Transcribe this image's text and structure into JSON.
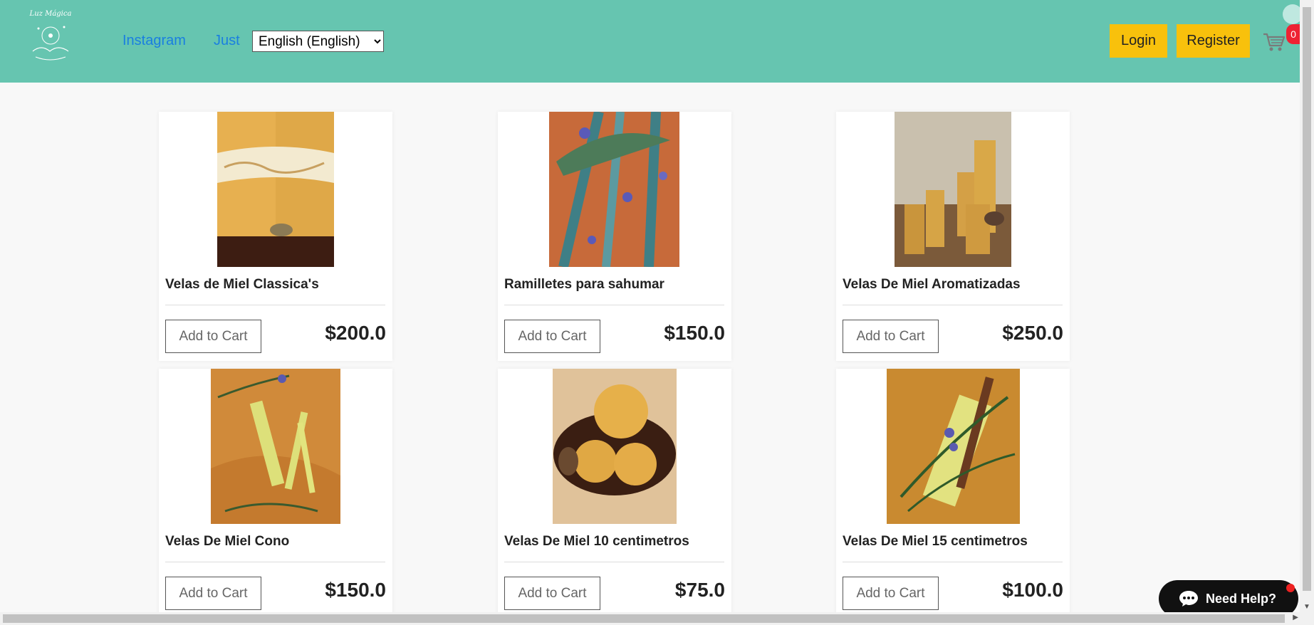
{
  "header": {
    "logo_text": "Luz Mágica",
    "nav": [
      {
        "label": "Instagram"
      },
      {
        "label": "Just"
      }
    ],
    "language": {
      "selected": "English (English)"
    },
    "login_label": "Login",
    "register_label": "Register",
    "cart_count": "0"
  },
  "products": [
    {
      "name": "Velas de Miel Classica's",
      "price": "$200.0",
      "add_label": "Add to Cart"
    },
    {
      "name": "Ramilletes para sahumar",
      "price": "$150.0",
      "add_label": "Add to Cart"
    },
    {
      "name": "Velas De Miel Aromatizadas",
      "price": "$250.0",
      "add_label": "Add to Cart"
    },
    {
      "name": "Velas De Miel Cono",
      "price": "$150.0",
      "add_label": "Add to Cart"
    },
    {
      "name": "Velas De Miel 10 centimetros",
      "price": "$75.0",
      "add_label": "Add to Cart"
    },
    {
      "name": "Velas De Miel 15 centimetros",
      "price": "$100.0",
      "add_label": "Add to Cart"
    }
  ],
  "chat": {
    "label": "Need Help?"
  },
  "colors": {
    "header_bg": "#66c5b0",
    "button_yellow": "#f8c10c",
    "link_blue": "#1a7fe0"
  }
}
